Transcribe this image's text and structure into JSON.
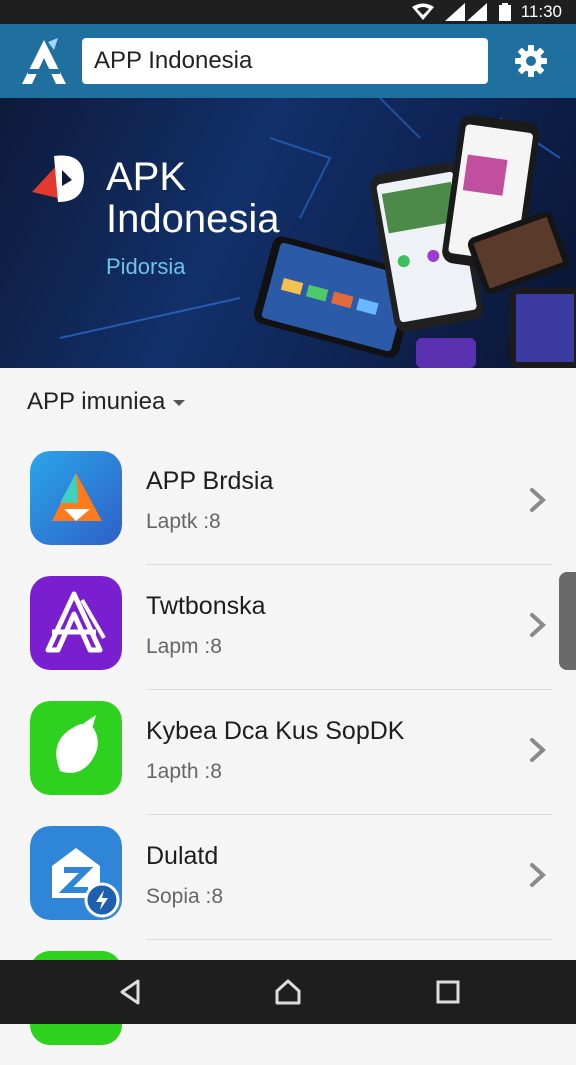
{
  "status_bar": {
    "time": "11:30"
  },
  "app_bar": {
    "search_value": "APP Indonesia"
  },
  "banner": {
    "title": "APK Indonesia",
    "subtitle": "Pidorsia"
  },
  "section": {
    "heading": "APP imuniea"
  },
  "apps": [
    {
      "title": "APP Brdsia",
      "subtitle": "Laptk :8",
      "icon": "app-brdsia-icon",
      "color": "#2f73c9"
    },
    {
      "title": "Twtbonska",
      "subtitle": "Lapm :8",
      "icon": "app-twtbonska-icon",
      "color": "#7a1fd0"
    },
    {
      "title": "Kybea Dca Kus SopDK",
      "subtitle": "1apth :8",
      "icon": "app-kybea-icon",
      "color": "#2fd11f"
    },
    {
      "title": "Dulatd",
      "subtitle": "Sopia :8",
      "icon": "app-dulatd-icon",
      "color": "#2f86d8"
    }
  ],
  "colors": {
    "app_bar": "#1f6f9f",
    "accent": "#6ec3e8"
  }
}
